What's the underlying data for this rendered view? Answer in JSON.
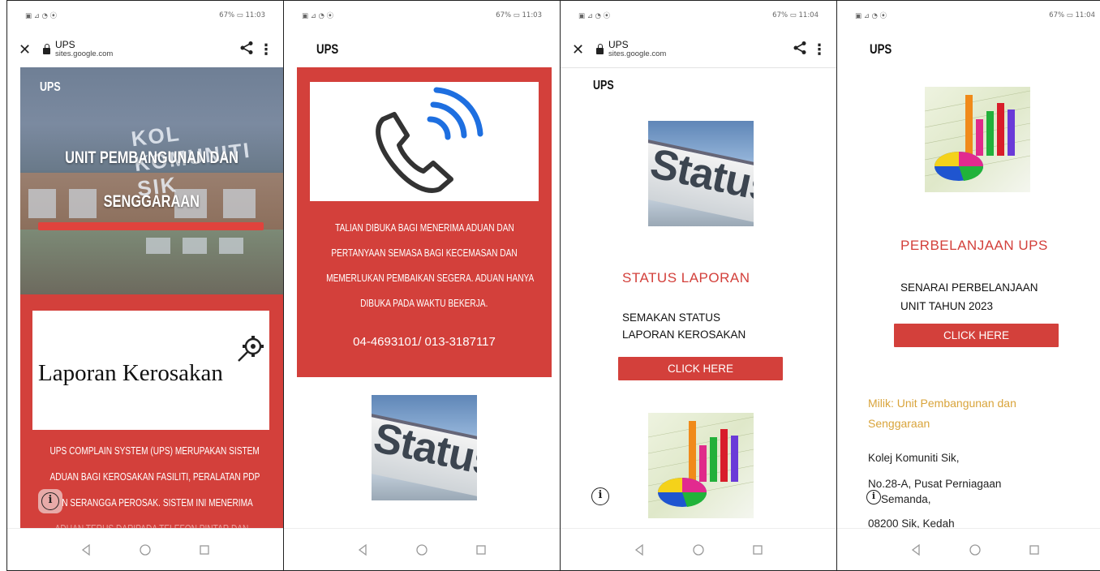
{
  "status_bar": {
    "p1": {
      "left": "▣ ⊿ ◔ ⦿",
      "right": "67% ▭ 11:03"
    },
    "p2": {
      "left": "▣ ⊿ ◔ ⦿",
      "right": "67% ▭ 11:03"
    },
    "p3": {
      "left": "▣ ⊿ ◔ ⦿",
      "right": "67% ▭ 11:04"
    },
    "p4": {
      "left": "▣ ⊿ ◔ ⦿",
      "right": "67% ▭ 11:04"
    }
  },
  "browser": {
    "title": "UPS",
    "domain": "sites.google.com"
  },
  "panel1": {
    "site_name": "UPS",
    "building_sign": "KOL  KOMUNITI  SIK",
    "hero_title_1": "UNIT PEMBANGUNAN DAN",
    "hero_title_2": "SENGGARAAN",
    "card_text": "Laporan Kerosakan",
    "desc_lines": [
      "UPS COMPLAIN SYSTEM (UPS) MERUPAKAN SISTEM",
      "ADUAN BAGI KEROSAKAN FASILITI, PERALATAN PDP",
      "DAN SERANGGA PEROSAK. SISTEM INI MENERIMA",
      "ADUAN TERUS DARIPADA TELEFON PINTAR DAN"
    ]
  },
  "panel2": {
    "site_name": "UPS",
    "desc_lines": [
      "TALIAN DIBUKA BAGI MENERIMA ADUAN DAN",
      "PERTANYAAN SEMASA BAGI KECEMASAN DAN",
      "MEMERLUKAN PEMBAIKAN SEGERA. ADUAN HANYA",
      "DIBUKA PADA WAKTU BEKERJA."
    ],
    "phone": "04-4693101/ 013-3187117",
    "status_image_word": "Status"
  },
  "panel3": {
    "site_name": "UPS",
    "status_image_word": "Status",
    "heading": "STATUS LAPORAN",
    "body_1": "SEMAKAN STATUS",
    "body_2": "LAPORAN KEROSAKAN",
    "button": "CLICK HERE"
  },
  "panel4": {
    "site_name": "UPS",
    "heading": "PERBELANJAAN UPS",
    "body_1": "SENARAI PERBELANJAAN",
    "body_2": "UNIT TAHUN 2023",
    "button": "CLICK HERE",
    "owner_1": "Milik: Unit Pembangunan dan",
    "owner_2": "Senggaraan",
    "addr_1": "Kolej Komuniti Sik,",
    "addr_2": "No.28-A, Pusat Perniagaan",
    "addr_3": "Semanda,",
    "addr_4": "08200 Sik, Kedah"
  },
  "icons": {
    "info": "i",
    "close": "✕",
    "menu": "⋮"
  },
  "colors": {
    "accent_red": "#d3403b",
    "owner_gold": "#d9a43b"
  }
}
